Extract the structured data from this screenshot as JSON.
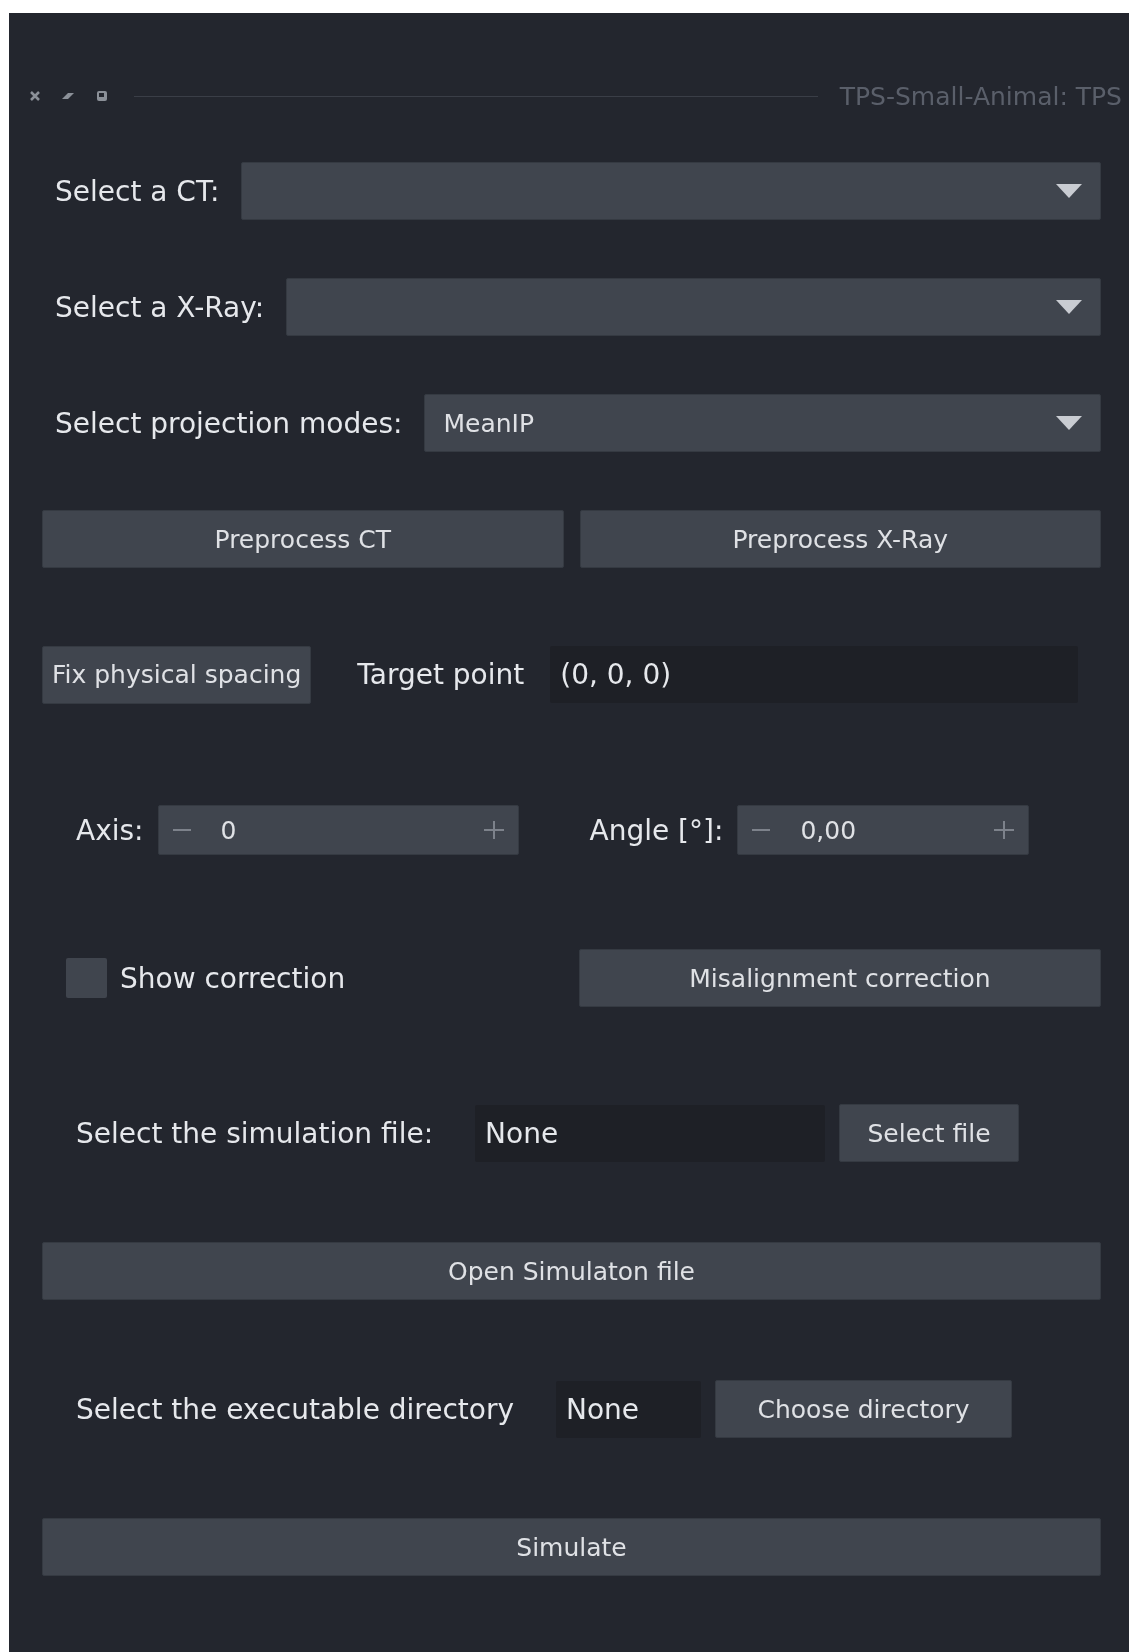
{
  "window": {
    "title": "TPS-Small-Animal: TPS"
  },
  "selectors": [
    {
      "label": "Select a CT:"
    },
    {
      "label": "Select a X-Ray:"
    },
    {
      "label": "Select projection modes:",
      "value": "MeanIP"
    }
  ],
  "preprocess_buttons": [
    "Preprocess CT",
    "Preprocess X-Ray"
  ],
  "spacing": {
    "button": "Fix physical spacing",
    "target_label": "Target point",
    "target_value": "(0, 0, 0)"
  },
  "spinboxes": [
    {
      "label": "Axis:",
      "value": "0"
    },
    {
      "label": "Angle [°]:",
      "value": "0,00"
    }
  ],
  "correction": {
    "checkbox_label": "Show correction",
    "checked": false,
    "button": "Misalignment correction"
  },
  "simulation_file": {
    "label": "Select the simulation file:",
    "value": "None",
    "button": "Select file"
  },
  "open_button": "Open Simulaton file",
  "executable": {
    "label": "Select the executable directory",
    "value": "None",
    "button": "Choose directory"
  },
  "simulate_button": "Simulate"
}
